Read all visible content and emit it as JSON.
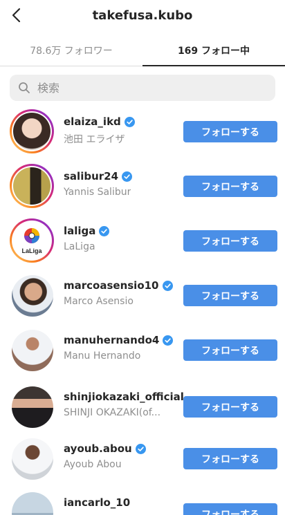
{
  "header": {
    "title": "takefusa.kubo",
    "back_icon": "chevron-left-icon"
  },
  "tabs": [
    {
      "label": "78.6万 フォロワー",
      "active": false
    },
    {
      "label": "169 フォロー中",
      "active": true
    }
  ],
  "search": {
    "placeholder": "検索",
    "icon": "search-icon"
  },
  "colors": {
    "follow_button": "#4a8fe7",
    "verified": "#3897f0",
    "ring_start": "#feda75",
    "ring_end": "#962fbf"
  },
  "list": [
    {
      "username": "elaiza_ikd",
      "full_name": "池田 エライザ",
      "verified": true,
      "story_ring": true,
      "button": "フォローする"
    },
    {
      "username": "salibur24",
      "full_name": "Yannis Salibur",
      "verified": true,
      "story_ring": true,
      "button": "フォローする"
    },
    {
      "username": "laliga",
      "full_name": "LaLiga",
      "verified": true,
      "story_ring": true,
      "avatar_text": "LaLiga",
      "button": "フォローする"
    },
    {
      "username": "marcoasensio10",
      "full_name": "Marco Asensio",
      "verified": true,
      "story_ring": false,
      "button": "フォローする"
    },
    {
      "username": "manuhernando4",
      "full_name": "Manu Hernando",
      "verified": true,
      "story_ring": false,
      "button": "フォローする"
    },
    {
      "username": "shinjiokazaki_official",
      "full_name": "SHINJI OKAZAKI(of...",
      "verified": false,
      "story_ring": false,
      "button": "フォローする"
    },
    {
      "username": "ayoub.abou",
      "full_name": "Ayoub Abou",
      "verified": true,
      "story_ring": false,
      "button": "フォローする"
    },
    {
      "username": "iancarlo_10",
      "full_name": "",
      "verified": false,
      "story_ring": false,
      "button": "フォローする"
    }
  ]
}
